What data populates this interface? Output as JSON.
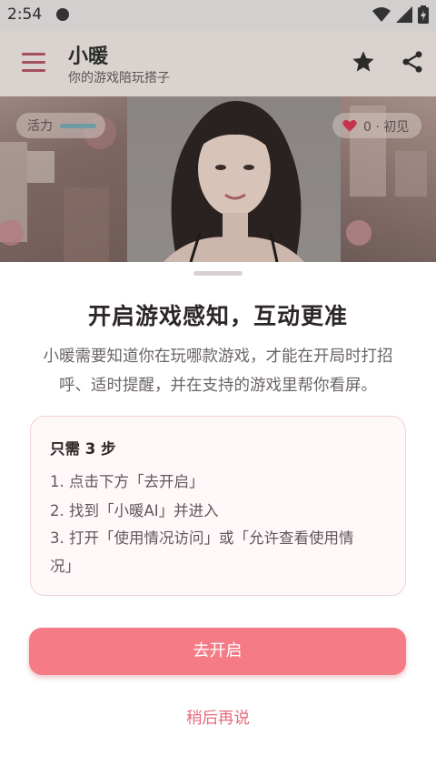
{
  "status_bar": {
    "time": "2:54",
    "icons": [
      "notification-dot-icon",
      "wifi-icon",
      "signal-icon",
      "battery-icon"
    ]
  },
  "app_bar": {
    "title": "小暖",
    "subtitle": "你的游戏陪玩搭子",
    "icons": [
      "menu-icon",
      "star-icon",
      "share-icon"
    ]
  },
  "hero": {
    "energy_label": "活力",
    "affinity_label": "0 · 初见",
    "heart_color": "#c4344a"
  },
  "sheet": {
    "title": "开启游戏感知，互动更准",
    "description_line1": "小暖需要知道你在玩哪款游戏，才能在开局时打招",
    "description_line2": "呼、适时提醒，并在支持的游戏里帮你看屏。",
    "steps_heading": "只需 3 步",
    "steps": [
      "1. 点击下方「去开启」",
      "2. 找到「小暖AI」并进入",
      "3. 打开「使用情况访问」或「允许查看使用情",
      "况」"
    ],
    "primary_button": "去开启",
    "secondary_button": "稍后再说"
  },
  "colors": {
    "accent": "#f57b86",
    "secondary_text_accent": "#e46d7d",
    "card_border": "#efd2d6",
    "card_bg": "#fff8f9"
  }
}
